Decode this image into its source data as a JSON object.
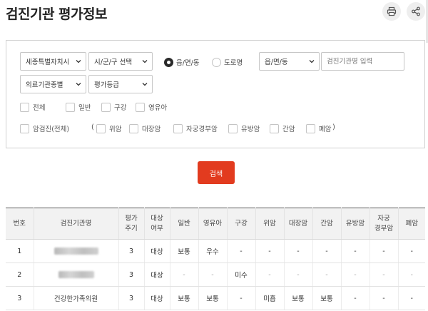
{
  "page": {
    "title": "검진기관 평가정보"
  },
  "icons": {
    "print": "print-icon",
    "share": "share-icon"
  },
  "filters": {
    "region_select": "세종특별자치시",
    "district_select": "시/군/구 선택",
    "radio_eupmyeondong": "읍/면/동",
    "radio_road": "도로명",
    "eupmyeondong_select": "읍/면/동",
    "institution_placeholder": "검진기관명 입력",
    "institution_type_select": "의료기관종별",
    "grade_select": "평가등급",
    "checkboxes_row1": [
      "전체",
      "일반",
      "구강",
      "영유아"
    ],
    "checkbox_cancer_all": "암검진(전체)",
    "paren_open": "(",
    "checkboxes_cancer": [
      "위암",
      "대장암",
      "자궁경부암",
      "유방암",
      "간암",
      "폐암"
    ],
    "paren_close": ")"
  },
  "search_label": "검색",
  "colors": {
    "accent": "#e23b1f",
    "header_bg": "#f2f2f2"
  },
  "table": {
    "headers": [
      "번호",
      "검진기관명",
      "평가\n주기",
      "대상\n여부",
      "일반",
      "영유아",
      "구강",
      "위암",
      "대장암",
      "간암",
      "유방암",
      "자궁\n경부암",
      "폐암"
    ],
    "rows": [
      {
        "no": "1",
        "name": "",
        "cycle": "3",
        "target": "대상",
        "general": "보통",
        "infant": "우수",
        "dental": "-",
        "stomach": "-",
        "colon": "-",
        "liver": "-",
        "breast": "-",
        "cervical": "-",
        "lung": "-"
      },
      {
        "no": "2",
        "name": "",
        "cycle": "3",
        "target": "대상",
        "general": "-",
        "infant": "-",
        "dental": "미수",
        "stomach": "-",
        "colon": "-",
        "liver": "-",
        "breast": "-",
        "cervical": "-",
        "lung": "-"
      },
      {
        "no": "3",
        "name": "건강한가족의원",
        "cycle": "3",
        "target": "대상",
        "general": "보통",
        "infant": "보통",
        "dental": "-",
        "stomach": "미흡",
        "colon": "보통",
        "liver": "보통",
        "breast": "-",
        "cervical": "-",
        "lung": "-"
      }
    ]
  }
}
